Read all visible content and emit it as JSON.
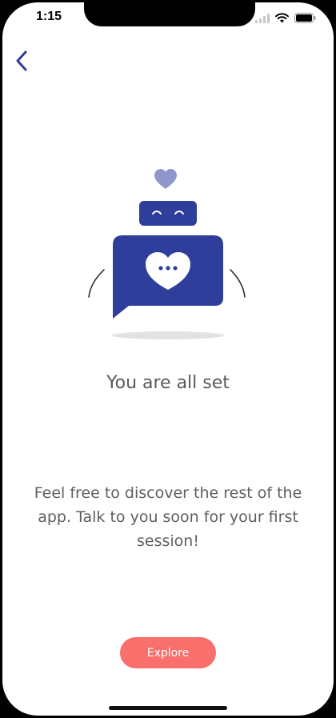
{
  "status_bar": {
    "time": "1:15",
    "icons": [
      "signal-icon",
      "wifi-icon",
      "battery-icon"
    ]
  },
  "nav": {
    "back_icon": "chevron-left-icon"
  },
  "illustration": {
    "icon": "chat-bot-heart-icon",
    "colors": {
      "primary": "#2f3e9a",
      "heart_top": "#8f96cc",
      "shadow": "#e2e2e2"
    }
  },
  "content": {
    "title": "You are all set",
    "description": "Feel free to discover the rest of the app. Talk to you soon for your first session!"
  },
  "actions": {
    "explore_label": "Explore",
    "accent_color": "#f86f6c"
  }
}
